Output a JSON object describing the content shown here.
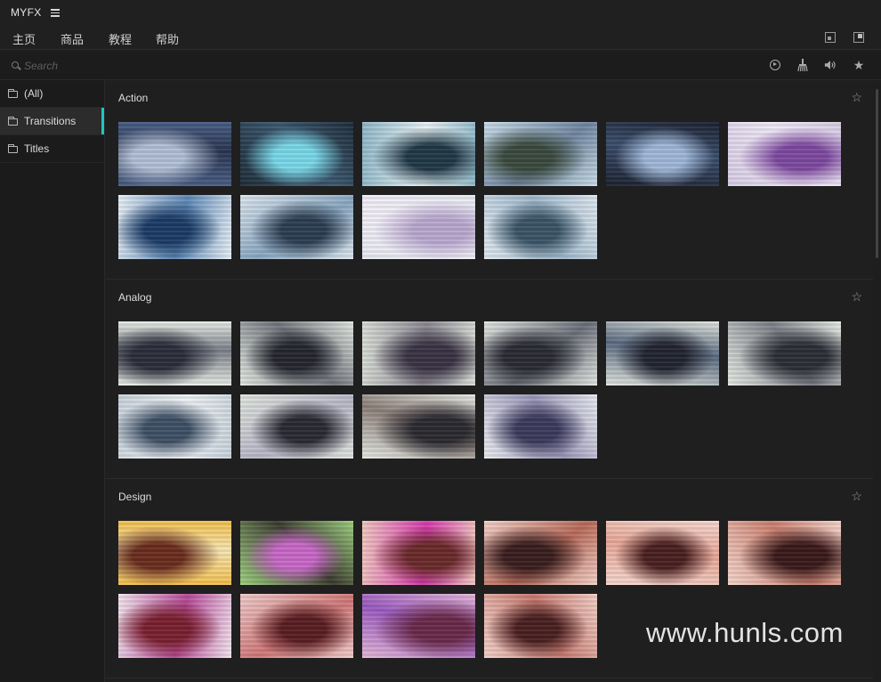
{
  "app": {
    "title": "MYFX"
  },
  "nav": {
    "items": [
      "主页",
      "商品",
      "教程",
      "帮助"
    ]
  },
  "search": {
    "placeholder": "Search"
  },
  "toolbar": {
    "icons": [
      "play-circle-icon",
      "broom-icon",
      "volume-icon",
      "star-icon"
    ]
  },
  "sidebar": {
    "items": [
      {
        "label": "(All)",
        "active": false
      },
      {
        "label": "Transitions",
        "active": true
      },
      {
        "label": "Titles",
        "active": false
      }
    ]
  },
  "sections": [
    {
      "title": "Action",
      "thumbs": [
        {
          "c1": "#4a5f86",
          "c2": "#b2bfd6",
          "c3": "#2b3550"
        },
        {
          "c1": "#1f2e3a",
          "c2": "#79d8e8",
          "c3": "#3c5870"
        },
        {
          "c1": "#8fb8c8",
          "c2": "#203846",
          "c3": "#e9f2f5"
        },
        {
          "c1": "#c9dde8",
          "c2": "#3b4a3e",
          "c3": "#6f86a0"
        },
        {
          "c1": "#1c2230",
          "c2": "#9fb7d8",
          "c3": "#3b4e6c"
        },
        {
          "c1": "#d8cde6",
          "c2": "#7e4aa0",
          "c3": "#efe9f6"
        },
        {
          "c1": "#e8f0f6",
          "c2": "#1c3c66",
          "c3": "#5d89b8"
        },
        {
          "c1": "#dce6ee",
          "c2": "#2c3e52",
          "c3": "#8aa8c2"
        },
        {
          "c1": "#e7eaf3",
          "c2": "#b9a8cf",
          "c3": "#f3eef7"
        },
        {
          "c1": "#dfe8ef",
          "c2": "#3a5466",
          "c3": "#9fb8cc"
        }
      ]
    },
    {
      "title": "Analog",
      "thumbs": [
        {
          "c1": "#e8ece6",
          "c2": "#2b2d3a",
          "c3": "#7a7f88"
        },
        {
          "c1": "#e3e8e2",
          "c2": "#25262f",
          "c3": "#71757c"
        },
        {
          "c1": "#d9ded7",
          "c2": "#3a3344",
          "c3": "#8a8792"
        },
        {
          "c1": "#e4e8e3",
          "c2": "#2a2b34",
          "c3": "#6a6e78"
        },
        {
          "c1": "#e2e6e0",
          "c2": "#222530",
          "c3": "#5a6a80"
        },
        {
          "c1": "#e6eae4",
          "c2": "#2c2e36",
          "c3": "#7c8088"
        },
        {
          "c1": "#c9d3dc",
          "c2": "#3f5066",
          "c3": "#eef2f5"
        },
        {
          "c1": "#e1e5df",
          "c2": "#2a2a34",
          "c3": "#b8b8c8"
        },
        {
          "c1": "#e6e9e4",
          "c2": "#2b2a30",
          "c3": "#8c7f78"
        },
        {
          "c1": "#e8ebf0",
          "c2": "#3c3a5c",
          "c3": "#9a96b8"
        }
      ]
    },
    {
      "title": "Design",
      "thumbs": [
        {
          "c1": "#f3c050",
          "c2": "#6a2e1e",
          "c3": "#f6e6b0"
        },
        {
          "c1": "#9fd080",
          "c2": "#c868c8",
          "c3": "#3c3c30"
        },
        {
          "c1": "#f0c8c0",
          "c2": "#6a2a2a",
          "c3": "#d83ab0"
        },
        {
          "c1": "#f4d2c8",
          "c2": "#3a1e1e",
          "c3": "#b86a5a"
        },
        {
          "c1": "#f6d8d0",
          "c2": "#4a2020",
          "c3": "#e8a898"
        },
        {
          "c1": "#f4d6cc",
          "c2": "#3a1a1a",
          "c3": "#cc8070"
        },
        {
          "c1": "#f2e6ee",
          "c2": "#7a2030",
          "c3": "#b84a9a"
        },
        {
          "c1": "#f0cccc",
          "c2": "#5a1e22",
          "c3": "#d07878"
        },
        {
          "c1": "#e4b8d8",
          "c2": "#6a2a4a",
          "c3": "#9a5ac0"
        },
        {
          "c1": "#f2d0c8",
          "c2": "#4a2020",
          "c3": "#c87a70"
        }
      ]
    }
  ],
  "watermark": {
    "text": "www.hunls.com"
  }
}
